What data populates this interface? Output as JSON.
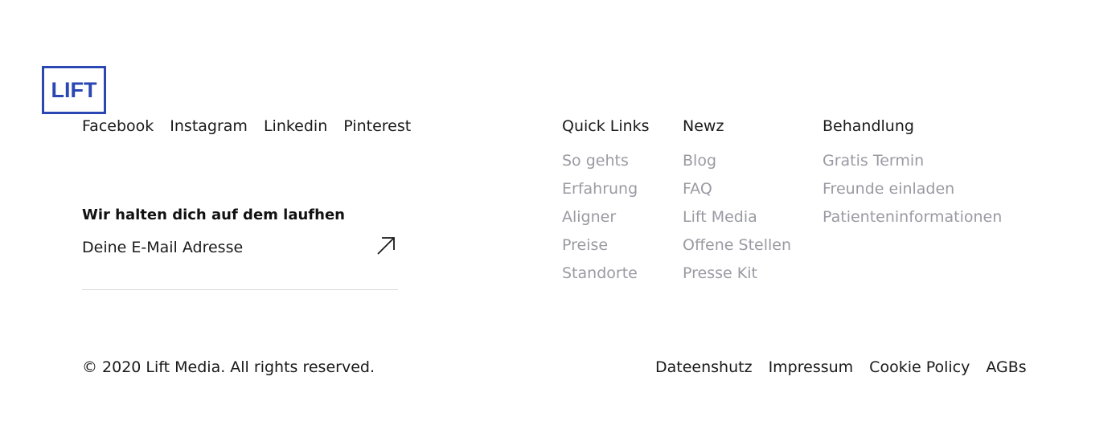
{
  "brand": {
    "logo_text": "LIFT",
    "logo_color": "#2b47b3"
  },
  "social": [
    {
      "label": "Facebook"
    },
    {
      "label": "Instagram"
    },
    {
      "label": "Linkedin"
    },
    {
      "label": "Pinterest"
    }
  ],
  "newsletter": {
    "title": "Wir halten dich auf dem laufhen",
    "placeholder": "Deine E-Mail Adresse",
    "submit_icon": "arrow-up-right-icon"
  },
  "columns": [
    {
      "title": "Quick Links",
      "links": [
        "So gehts",
        "Erfahrung",
        "Aligner",
        "Preise",
        "Standorte"
      ]
    },
    {
      "title": "Newz",
      "links": [
        "Blog",
        "FAQ",
        "Lift Media",
        "Offene Stellen",
        "Presse Kit"
      ]
    },
    {
      "title": "Behandlung",
      "links": [
        "Gratis Termin",
        "Freunde einladen",
        "Patienteninformationen"
      ]
    }
  ],
  "footer": {
    "copyright": "© 2020 Lift Media. All rights reserved.",
    "legal_links": [
      "Dateenshutz",
      "Impressum",
      "Cookie Policy",
      "AGBs"
    ]
  },
  "colors": {
    "link_muted": "#9a9aa3",
    "text": "#1a1a1a",
    "divider": "#d9d9d9"
  }
}
